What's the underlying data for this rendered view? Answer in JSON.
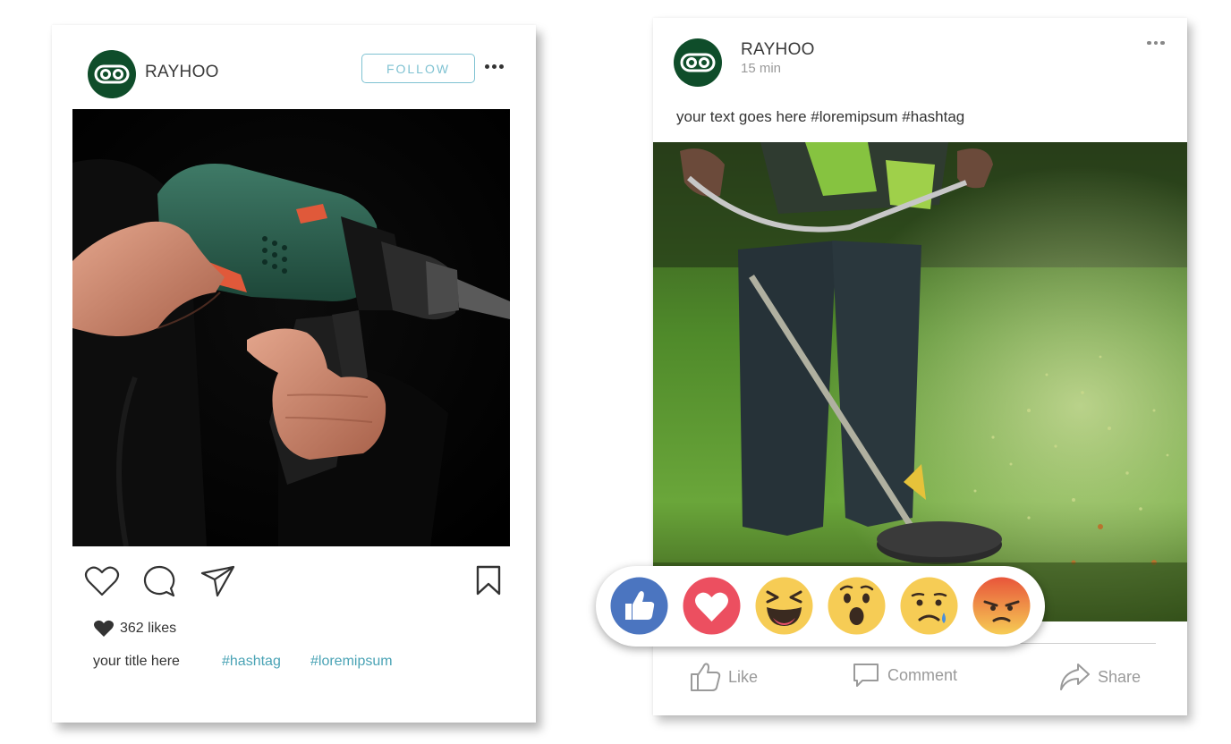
{
  "post_left": {
    "account_name": "RAYHOO",
    "follow_label": "FOLLOW",
    "likes_text": "362 likes",
    "caption": "your title here",
    "hashtags": [
      "#hashtag",
      "#loremipsum"
    ],
    "icons": [
      "logo-icon",
      "more-icon",
      "heart-icon",
      "comment-icon",
      "send-icon",
      "bookmark-icon"
    ],
    "accent_color": "#4aa3b5"
  },
  "post_right": {
    "account_name": "RAYHOO",
    "time": "15 min",
    "text": "your text goes here #loremipsum #hashtag",
    "actions": {
      "like": "Like",
      "comment": "Comment",
      "share": "Share"
    },
    "reactions": [
      "like-reaction",
      "love-reaction",
      "haha-reaction",
      "wow-reaction",
      "sad-reaction",
      "angry-reaction"
    ],
    "brand_color": "#0f4d2a"
  }
}
